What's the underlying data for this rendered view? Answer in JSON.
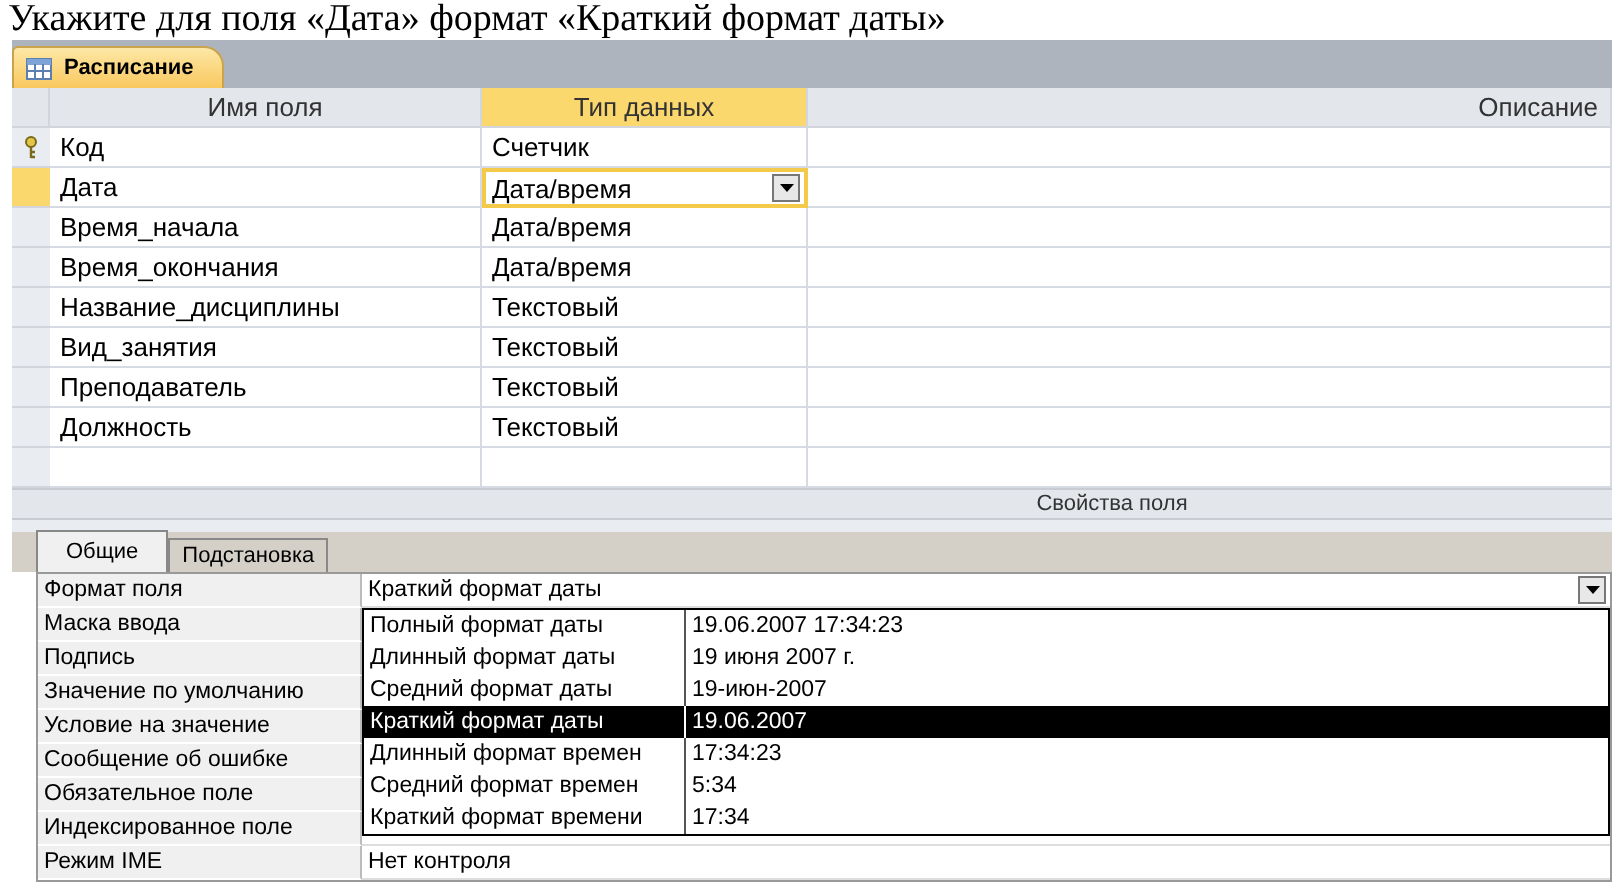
{
  "caption": "Укажите для поля «Дата» формат «Краткий формат даты»",
  "document_tab": {
    "label": "Расписание"
  },
  "fields_table": {
    "columns": [
      "Имя поля",
      "Тип данных",
      "Описание"
    ],
    "rows": [
      {
        "name": "Код",
        "type": "Счетчик",
        "primary_key": true,
        "selected": false
      },
      {
        "name": "Дата",
        "type": "Дата/время",
        "primary_key": false,
        "selected": true
      },
      {
        "name": "Время_начала",
        "type": "Дата/время",
        "primary_key": false,
        "selected": false
      },
      {
        "name": "Время_окончания",
        "type": "Дата/время",
        "primary_key": false,
        "selected": false
      },
      {
        "name": "Название_дисциплины",
        "type": "Текстовый",
        "primary_key": false,
        "selected": false
      },
      {
        "name": "Вид_занятия",
        "type": "Текстовый",
        "primary_key": false,
        "selected": false
      },
      {
        "name": "Преподаватель",
        "type": "Текстовый",
        "primary_key": false,
        "selected": false
      },
      {
        "name": "Должность",
        "type": "Текстовый",
        "primary_key": false,
        "selected": false
      }
    ]
  },
  "properties_header": "Свойства поля",
  "property_tabs": [
    {
      "label": "Общие",
      "selected": true
    },
    {
      "label": "Подстановка",
      "selected": false
    }
  ],
  "properties": [
    {
      "label": "Формат поля",
      "value": "Краткий формат даты"
    },
    {
      "label": "Маска ввода"
    },
    {
      "label": "Подпись"
    },
    {
      "label": "Значение по умолчанию"
    },
    {
      "label": "Условие на значение"
    },
    {
      "label": "Сообщение об ошибке"
    },
    {
      "label": "Обязательное поле"
    },
    {
      "label": "Индексированное поле"
    },
    {
      "label": "Режим IME",
      "value": "Нет контроля"
    }
  ],
  "format_dropdown": {
    "options": [
      {
        "name": "Полный формат даты",
        "example": "19.06.2007 17:34:23",
        "selected": false
      },
      {
        "name": "Длинный формат даты",
        "example": "19 июня 2007 г.",
        "selected": false
      },
      {
        "name": "Средний формат даты",
        "example": "19-июн-2007",
        "selected": false
      },
      {
        "name": "Краткий формат даты",
        "example": "19.06.2007",
        "selected": true
      },
      {
        "name": "Длинный формат времен",
        "example": "17:34:23",
        "selected": false
      },
      {
        "name": "Средний формат времен",
        "example": "5:34",
        "selected": false
      },
      {
        "name": "Краткий формат времени",
        "example": "17:34",
        "selected": false
      }
    ]
  }
}
